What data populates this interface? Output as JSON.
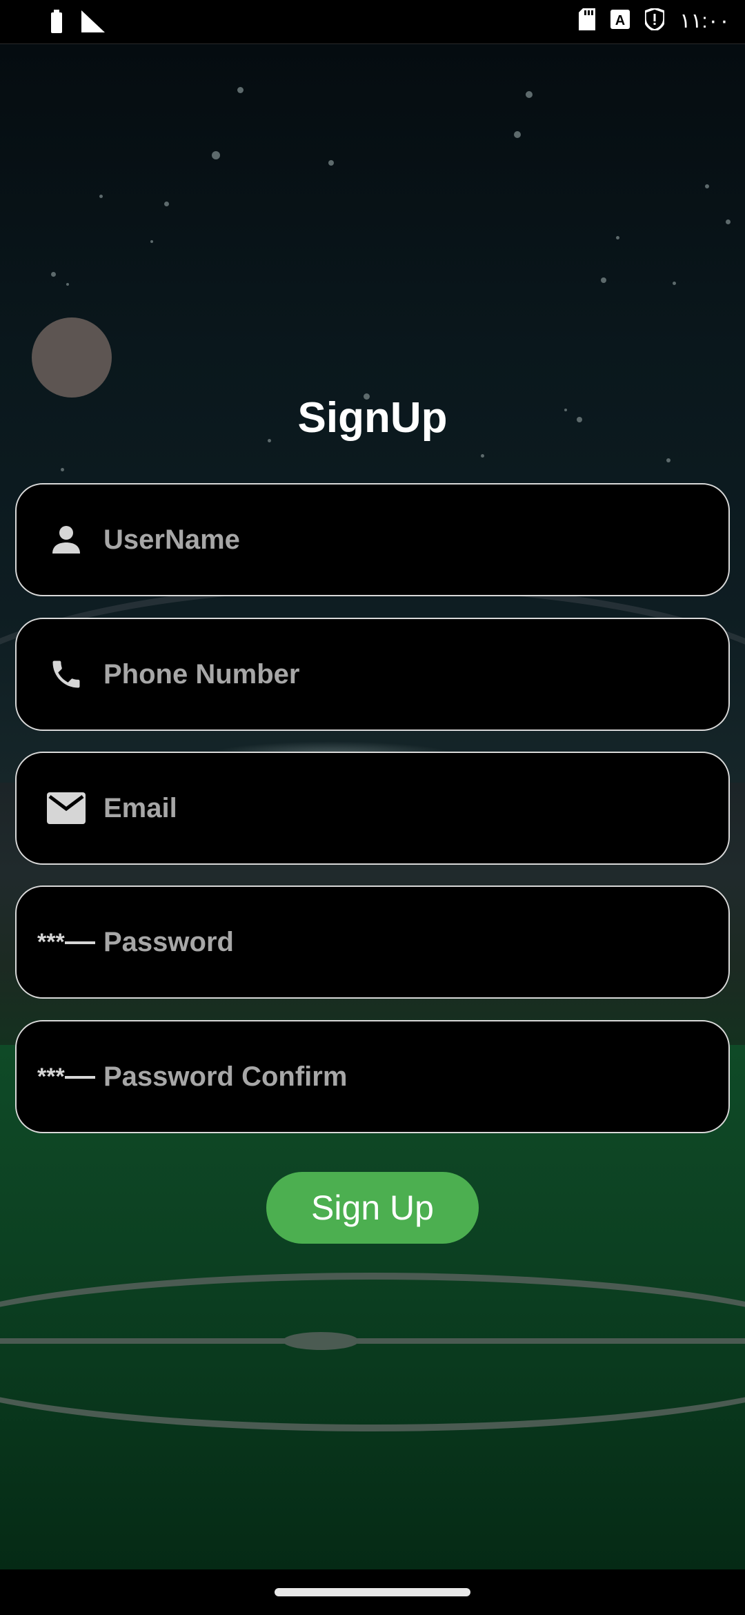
{
  "status_bar": {
    "time": "١١:٠٠",
    "left_icons": [
      "battery-icon",
      "signal-icon"
    ],
    "right_icons": [
      "sd-card-icon",
      "keyboard-a-icon",
      "shield-icon"
    ]
  },
  "form": {
    "title": "SignUp",
    "fields": [
      {
        "placeholder": "UserName",
        "icon": "person-icon"
      },
      {
        "placeholder": "Phone Number",
        "icon": "phone-icon"
      },
      {
        "placeholder": "Email",
        "icon": "mail-icon"
      },
      {
        "placeholder": "Password",
        "icon": "password-icon"
      },
      {
        "placeholder": "Password Confirm",
        "icon": "password-icon"
      }
    ],
    "submit_label": "Sign Up"
  },
  "colors": {
    "button": "#4caf50",
    "field_background": "#000000",
    "field_border": "#d9d9d9",
    "placeholder": "#a7a7a7"
  }
}
